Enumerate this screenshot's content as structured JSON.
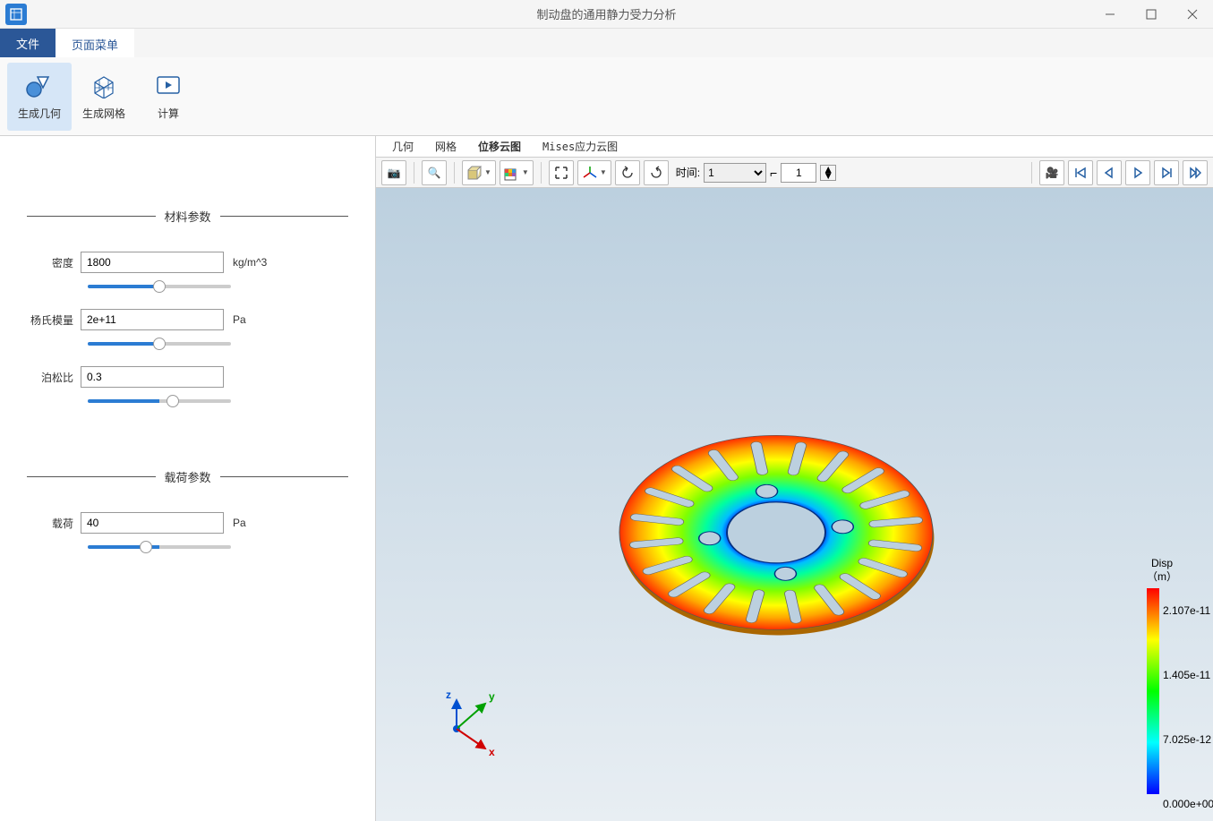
{
  "window": {
    "title": "制动盘的通用静力受力分析"
  },
  "menu": {
    "file": "文件",
    "page": "页面菜单"
  },
  "ribbon": {
    "geom": "生成几何",
    "mesh": "生成网格",
    "compute": "计算"
  },
  "sidebar": {
    "section_material": "材料参数",
    "section_load": "载荷参数",
    "density": {
      "label": "密度",
      "value": "1800",
      "unit": "kg/m^3"
    },
    "youngs": {
      "label": "杨氏模量",
      "value": "2e+11",
      "unit": "Pa"
    },
    "poisson": {
      "label": "泊松比",
      "value": "0.3",
      "unit": ""
    },
    "load": {
      "label": "载荷",
      "value": "40",
      "unit": "Pa"
    }
  },
  "viewer": {
    "tabs": {
      "geom": "几何",
      "mesh": "网格",
      "disp": "位移云图",
      "mises": "Mises应力云图"
    },
    "time_label": "时间:",
    "time_value": "1",
    "frame_value": "1"
  },
  "legend": {
    "title1": "Disp",
    "title2": "（m）",
    "t0": "2.107e-11",
    "t1": "1.405e-11",
    "t2": "7.025e-12",
    "t3": "0.000e+00"
  }
}
